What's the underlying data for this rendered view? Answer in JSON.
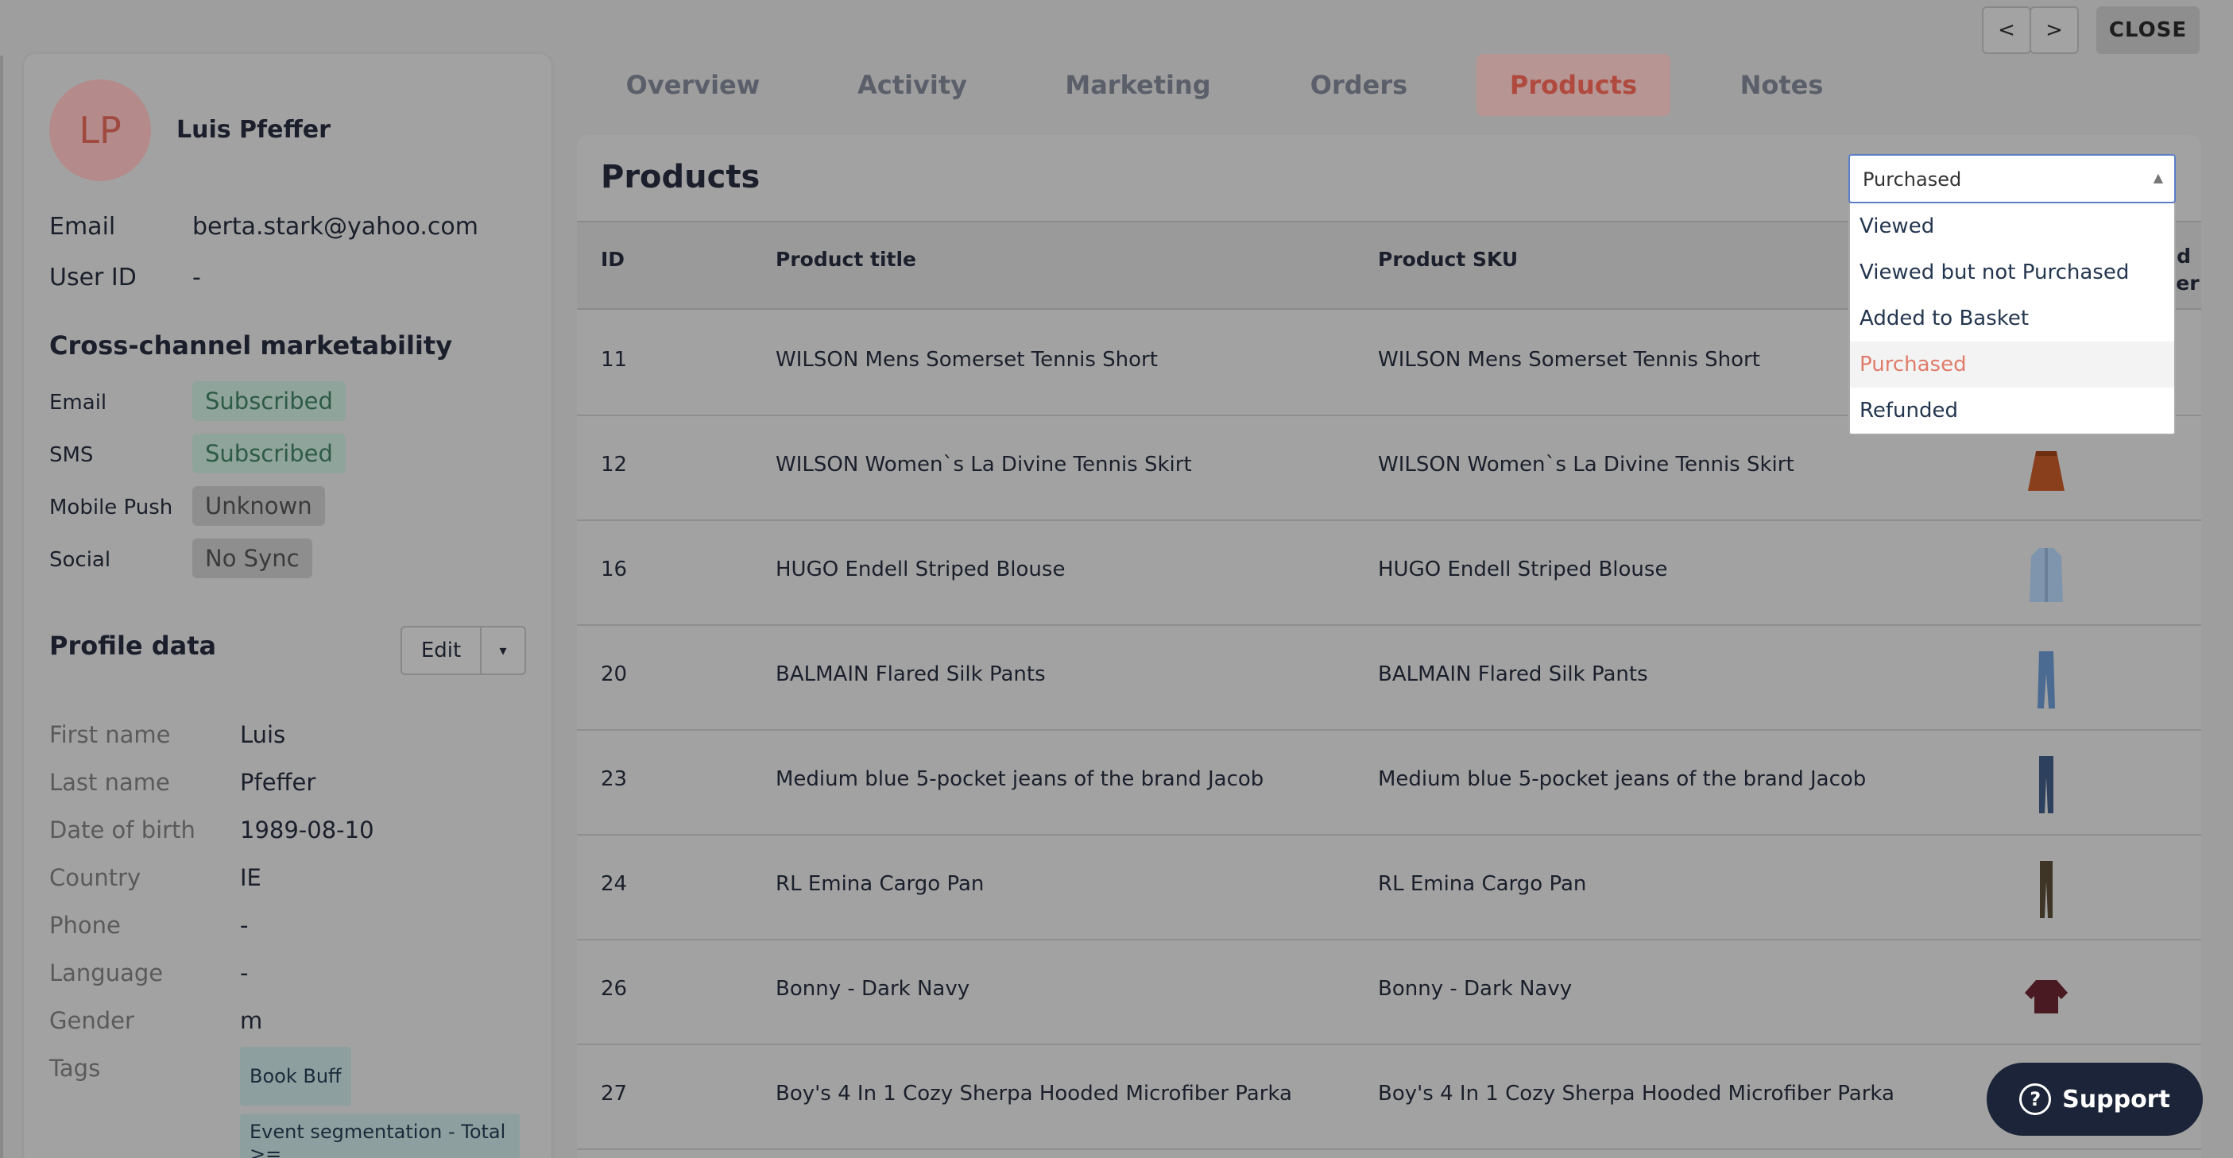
{
  "window": {
    "prev_label": "<",
    "next_label": ">",
    "close_label": "CLOSE"
  },
  "profile": {
    "initials": "LP",
    "name": "Luis Pfeffer",
    "email_label": "Email",
    "email": "berta.stark@yahoo.com",
    "user_id_label": "User ID",
    "user_id": "-"
  },
  "marketability": {
    "title": "Cross-channel marketability",
    "channels": [
      {
        "label": "Email",
        "status": "Subscribed",
        "color": "#2e5a48"
      },
      {
        "label": "SMS",
        "status": "Subscribed",
        "color": "#2e5a48"
      },
      {
        "label": "Mobile Push",
        "status": "Unknown",
        "color": "#3b3b3b"
      },
      {
        "label": "Social",
        "status": "No Sync",
        "color": "#3b3b3b"
      }
    ]
  },
  "profile_data": {
    "title": "Profile data",
    "edit_label": "Edit",
    "fields": [
      {
        "label": "First name",
        "value": "Luis"
      },
      {
        "label": "Last name",
        "value": "Pfeffer"
      },
      {
        "label": "Date of birth",
        "value": "1989-08-10"
      },
      {
        "label": "Country",
        "value": "IE"
      },
      {
        "label": "Phone",
        "value": "-"
      },
      {
        "label": "Language",
        "value": "-"
      },
      {
        "label": "Gender",
        "value": "m"
      }
    ],
    "tags_label": "Tags",
    "tags": [
      "Book Buff",
      "Event segmentation - Total >="
    ]
  },
  "tabs": [
    {
      "label": "Overview",
      "active": false
    },
    {
      "label": "Activity",
      "active": false
    },
    {
      "label": "Marketing",
      "active": false
    },
    {
      "label": "Orders",
      "active": false
    },
    {
      "label": "Products",
      "active": true
    },
    {
      "label": "Notes",
      "active": false
    }
  ],
  "products": {
    "title": "Products",
    "filter": {
      "selected": "Purchased",
      "options": [
        "Viewed",
        "Viewed but not Purchased",
        "Added to Basket",
        "Purchased",
        "Refunded"
      ]
    },
    "columns": {
      "id": "ID",
      "title": "Product title",
      "sku": "Product SKU",
      "partial": "od\nver"
    },
    "rows": [
      {
        "id": "11",
        "title": "WILSON Mens Somerset Tennis Short",
        "sku": "WILSON Mens Somerset Tennis Short",
        "thumb": "none"
      },
      {
        "id": "12",
        "title": "WILSON Women`s La Divine Tennis Skirt",
        "sku": "WILSON Women`s La Divine Tennis Skirt",
        "thumb": "skirt"
      },
      {
        "id": "16",
        "title": "HUGO Endell Striped Blouse",
        "sku": "HUGO Endell Striped Blouse",
        "thumb": "blouse"
      },
      {
        "id": "20",
        "title": "BALMAIN Flared Silk Pants",
        "sku": "BALMAIN Flared Silk Pants",
        "thumb": "flared-pants"
      },
      {
        "id": "23",
        "title": "Medium blue 5-pocket jeans of the brand Jacob",
        "sku": "Medium blue 5-pocket jeans of the brand Jacob",
        "thumb": "jeans"
      },
      {
        "id": "24",
        "title": "RL Emina Cargo Pan",
        "sku": "RL Emina Cargo Pan",
        "thumb": "cargo-pants"
      },
      {
        "id": "26",
        "title": "Bonny - Dark Navy",
        "sku": "Bonny - Dark Navy",
        "thumb": "sweater"
      },
      {
        "id": "27",
        "title": "Boy's 4 In 1 Cozy Sherpa Hooded Microfiber Parka",
        "sku": "Boy's 4 In 1 Cozy Sherpa Hooded Microfiber Parka",
        "thumb": "none"
      }
    ]
  },
  "support": {
    "label": "Support"
  }
}
